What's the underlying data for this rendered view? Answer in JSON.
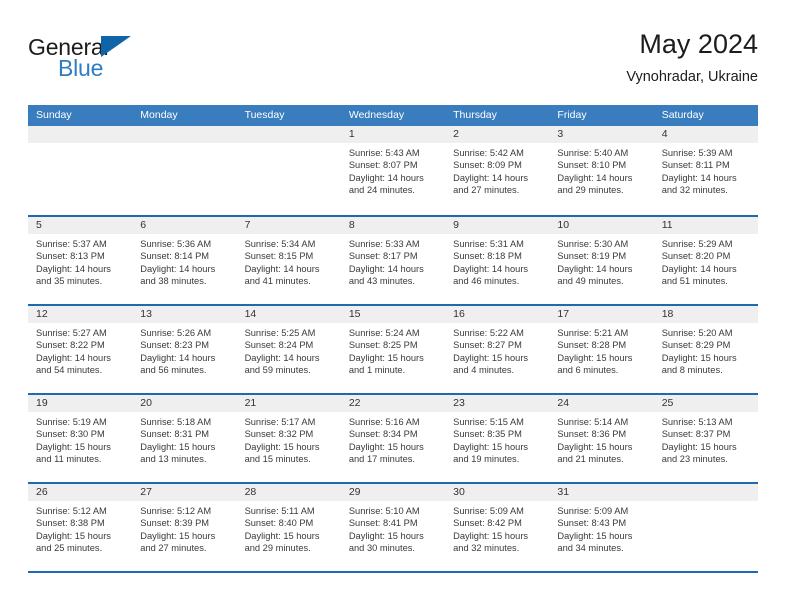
{
  "brand": {
    "name_part1": "General",
    "name_part2": "Blue",
    "logo_icon": "blue-triangle-logo"
  },
  "header": {
    "title": "May 2024",
    "subtitle": "Vynohradar, Ukraine"
  },
  "colors": {
    "header_blue": "#3a7dbf",
    "rule_blue": "#1f69b0",
    "day_band_gray": "#efefef",
    "brand_blue": "#2f7dc4",
    "logo_blue": "#1064a8",
    "text": "#1c1c1c"
  },
  "calendar": {
    "day_names": [
      "Sunday",
      "Monday",
      "Tuesday",
      "Wednesday",
      "Thursday",
      "Friday",
      "Saturday"
    ],
    "weeks": [
      [
        {
          "day": "",
          "empty": true
        },
        {
          "day": "",
          "empty": true
        },
        {
          "day": "",
          "empty": true
        },
        {
          "day": "1",
          "sunrise": "Sunrise: 5:43 AM",
          "sunset": "Sunset: 8:07 PM",
          "daylight1": "Daylight: 14 hours",
          "daylight2": "and 24 minutes."
        },
        {
          "day": "2",
          "sunrise": "Sunrise: 5:42 AM",
          "sunset": "Sunset: 8:09 PM",
          "daylight1": "Daylight: 14 hours",
          "daylight2": "and 27 minutes."
        },
        {
          "day": "3",
          "sunrise": "Sunrise: 5:40 AM",
          "sunset": "Sunset: 8:10 PM",
          "daylight1": "Daylight: 14 hours",
          "daylight2": "and 29 minutes."
        },
        {
          "day": "4",
          "sunrise": "Sunrise: 5:39 AM",
          "sunset": "Sunset: 8:11 PM",
          "daylight1": "Daylight: 14 hours",
          "daylight2": "and 32 minutes."
        }
      ],
      [
        {
          "day": "5",
          "sunrise": "Sunrise: 5:37 AM",
          "sunset": "Sunset: 8:13 PM",
          "daylight1": "Daylight: 14 hours",
          "daylight2": "and 35 minutes."
        },
        {
          "day": "6",
          "sunrise": "Sunrise: 5:36 AM",
          "sunset": "Sunset: 8:14 PM",
          "daylight1": "Daylight: 14 hours",
          "daylight2": "and 38 minutes."
        },
        {
          "day": "7",
          "sunrise": "Sunrise: 5:34 AM",
          "sunset": "Sunset: 8:15 PM",
          "daylight1": "Daylight: 14 hours",
          "daylight2": "and 41 minutes."
        },
        {
          "day": "8",
          "sunrise": "Sunrise: 5:33 AM",
          "sunset": "Sunset: 8:17 PM",
          "daylight1": "Daylight: 14 hours",
          "daylight2": "and 43 minutes."
        },
        {
          "day": "9",
          "sunrise": "Sunrise: 5:31 AM",
          "sunset": "Sunset: 8:18 PM",
          "daylight1": "Daylight: 14 hours",
          "daylight2": "and 46 minutes."
        },
        {
          "day": "10",
          "sunrise": "Sunrise: 5:30 AM",
          "sunset": "Sunset: 8:19 PM",
          "daylight1": "Daylight: 14 hours",
          "daylight2": "and 49 minutes."
        },
        {
          "day": "11",
          "sunrise": "Sunrise: 5:29 AM",
          "sunset": "Sunset: 8:20 PM",
          "daylight1": "Daylight: 14 hours",
          "daylight2": "and 51 minutes."
        }
      ],
      [
        {
          "day": "12",
          "sunrise": "Sunrise: 5:27 AM",
          "sunset": "Sunset: 8:22 PM",
          "daylight1": "Daylight: 14 hours",
          "daylight2": "and 54 minutes."
        },
        {
          "day": "13",
          "sunrise": "Sunrise: 5:26 AM",
          "sunset": "Sunset: 8:23 PM",
          "daylight1": "Daylight: 14 hours",
          "daylight2": "and 56 minutes."
        },
        {
          "day": "14",
          "sunrise": "Sunrise: 5:25 AM",
          "sunset": "Sunset: 8:24 PM",
          "daylight1": "Daylight: 14 hours",
          "daylight2": "and 59 minutes."
        },
        {
          "day": "15",
          "sunrise": "Sunrise: 5:24 AM",
          "sunset": "Sunset: 8:25 PM",
          "daylight1": "Daylight: 15 hours",
          "daylight2": "and 1 minute."
        },
        {
          "day": "16",
          "sunrise": "Sunrise: 5:22 AM",
          "sunset": "Sunset: 8:27 PM",
          "daylight1": "Daylight: 15 hours",
          "daylight2": "and 4 minutes."
        },
        {
          "day": "17",
          "sunrise": "Sunrise: 5:21 AM",
          "sunset": "Sunset: 8:28 PM",
          "daylight1": "Daylight: 15 hours",
          "daylight2": "and 6 minutes."
        },
        {
          "day": "18",
          "sunrise": "Sunrise: 5:20 AM",
          "sunset": "Sunset: 8:29 PM",
          "daylight1": "Daylight: 15 hours",
          "daylight2": "and 8 minutes."
        }
      ],
      [
        {
          "day": "19",
          "sunrise": "Sunrise: 5:19 AM",
          "sunset": "Sunset: 8:30 PM",
          "daylight1": "Daylight: 15 hours",
          "daylight2": "and 11 minutes."
        },
        {
          "day": "20",
          "sunrise": "Sunrise: 5:18 AM",
          "sunset": "Sunset: 8:31 PM",
          "daylight1": "Daylight: 15 hours",
          "daylight2": "and 13 minutes."
        },
        {
          "day": "21",
          "sunrise": "Sunrise: 5:17 AM",
          "sunset": "Sunset: 8:32 PM",
          "daylight1": "Daylight: 15 hours",
          "daylight2": "and 15 minutes."
        },
        {
          "day": "22",
          "sunrise": "Sunrise: 5:16 AM",
          "sunset": "Sunset: 8:34 PM",
          "daylight1": "Daylight: 15 hours",
          "daylight2": "and 17 minutes."
        },
        {
          "day": "23",
          "sunrise": "Sunrise: 5:15 AM",
          "sunset": "Sunset: 8:35 PM",
          "daylight1": "Daylight: 15 hours",
          "daylight2": "and 19 minutes."
        },
        {
          "day": "24",
          "sunrise": "Sunrise: 5:14 AM",
          "sunset": "Sunset: 8:36 PM",
          "daylight1": "Daylight: 15 hours",
          "daylight2": "and 21 minutes."
        },
        {
          "day": "25",
          "sunrise": "Sunrise: 5:13 AM",
          "sunset": "Sunset: 8:37 PM",
          "daylight1": "Daylight: 15 hours",
          "daylight2": "and 23 minutes."
        }
      ],
      [
        {
          "day": "26",
          "sunrise": "Sunrise: 5:12 AM",
          "sunset": "Sunset: 8:38 PM",
          "daylight1": "Daylight: 15 hours",
          "daylight2": "and 25 minutes."
        },
        {
          "day": "27",
          "sunrise": "Sunrise: 5:12 AM",
          "sunset": "Sunset: 8:39 PM",
          "daylight1": "Daylight: 15 hours",
          "daylight2": "and 27 minutes."
        },
        {
          "day": "28",
          "sunrise": "Sunrise: 5:11 AM",
          "sunset": "Sunset: 8:40 PM",
          "daylight1": "Daylight: 15 hours",
          "daylight2": "and 29 minutes."
        },
        {
          "day": "29",
          "sunrise": "Sunrise: 5:10 AM",
          "sunset": "Sunset: 8:41 PM",
          "daylight1": "Daylight: 15 hours",
          "daylight2": "and 30 minutes."
        },
        {
          "day": "30",
          "sunrise": "Sunrise: 5:09 AM",
          "sunset": "Sunset: 8:42 PM",
          "daylight1": "Daylight: 15 hours",
          "daylight2": "and 32 minutes."
        },
        {
          "day": "31",
          "sunrise": "Sunrise: 5:09 AM",
          "sunset": "Sunset: 8:43 PM",
          "daylight1": "Daylight: 15 hours",
          "daylight2": "and 34 minutes."
        },
        {
          "day": "",
          "empty": true
        }
      ]
    ]
  }
}
